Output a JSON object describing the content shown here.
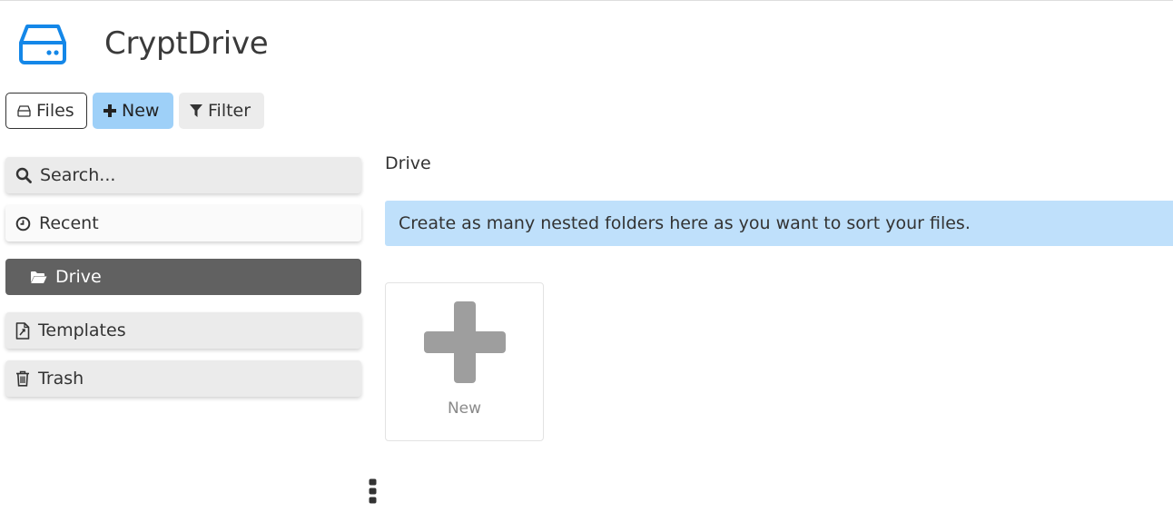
{
  "app": {
    "title": "CryptDrive"
  },
  "toolbar": {
    "files_label": "Files",
    "new_label": "New",
    "filter_label": "Filter"
  },
  "sidebar": {
    "search_placeholder": "Search...",
    "items": [
      {
        "label": "Recent",
        "icon": "clock-icon"
      },
      {
        "label": "Drive",
        "icon": "folder-open-icon",
        "active": true
      },
      {
        "label": "Templates",
        "icon": "template-file-icon"
      },
      {
        "label": "Trash",
        "icon": "trash-icon"
      }
    ]
  },
  "main": {
    "breadcrumb": "Drive",
    "info_banner": "Create as many nested folders here as you want to sort your files.",
    "new_tile_label": "New"
  },
  "colors": {
    "brand_icon": "#1487e8",
    "new_button": "#9ed0f8",
    "active_item": "#616161",
    "banner": "#bfe0fb"
  }
}
